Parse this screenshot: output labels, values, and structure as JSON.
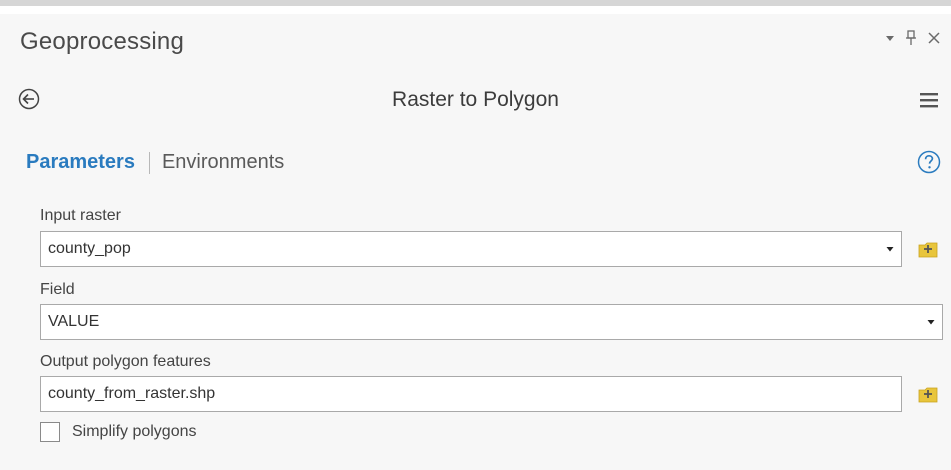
{
  "pane": {
    "title": "Geoprocessing",
    "controls": {
      "dropdown_icon": "caret-down-icon",
      "pin_icon": "pin-icon",
      "close_icon": "close-icon"
    }
  },
  "tool": {
    "title": "Raster to Polygon",
    "back_icon": "back-arrow-icon",
    "menu_icon": "hamburger-menu-icon"
  },
  "tabs": {
    "active": "Parameters",
    "inactive": "Environments",
    "help_icon": "help-icon"
  },
  "parameters": {
    "input_raster": {
      "label": "Input raster",
      "value": "county_pop"
    },
    "field": {
      "label": "Field",
      "value": "VALUE"
    },
    "output_polygon": {
      "label": "Output polygon features",
      "value": "county_from_raster.shp"
    },
    "simplify": {
      "label": "Simplify polygons",
      "checked": false
    }
  },
  "colors": {
    "accent": "#2a7bbf",
    "folder": "#e8c53c"
  }
}
